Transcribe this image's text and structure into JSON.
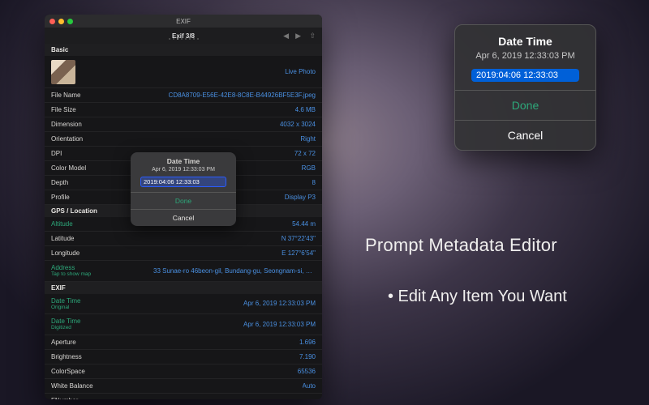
{
  "window": {
    "title": "EXIF",
    "counter": "Exif 3/8",
    "live_photo": "Live Photo",
    "sections": {
      "basic": "Basic",
      "gps": "GPS / Location",
      "exif": "EXIF"
    },
    "rows": {
      "file_name": {
        "label": "File Name",
        "value": "CD8A8709-E56E-42E8-8C8E-B44926BF5E3F.jpeg"
      },
      "file_size": {
        "label": "File Size",
        "value": "4.6 MB"
      },
      "dimension": {
        "label": "Dimension",
        "value": "4032 x 3024"
      },
      "orientation": {
        "label": "Orientation",
        "value": "Right"
      },
      "dpi": {
        "label": "DPI",
        "value": "72 x 72"
      },
      "color_model": {
        "label": "Color Model",
        "value": "RGB"
      },
      "depth": {
        "label": "Depth",
        "value": "8"
      },
      "profile": {
        "label": "Profile",
        "value": "Display P3"
      },
      "altitude": {
        "label": "Altitude",
        "value": "54.44 m"
      },
      "latitude": {
        "label": "Latitude",
        "value": "N 37°22'43\""
      },
      "longitude": {
        "label": "Longitude",
        "value": "E 127°6'54\""
      },
      "address": {
        "label": "Address",
        "sub": "Tap to show map",
        "value": "33 Sunae-ro 46beon-gil, Bundang-gu, Seongnam-si, Gyeonggi-…"
      },
      "date_time_orig": {
        "label": "Date Time",
        "sub": "Original",
        "value": "Apr 6, 2019 12:33:03 PM"
      },
      "date_time_digi": {
        "label": "Date Time",
        "sub": "Digitized",
        "value": "Apr 6, 2019 12:33:03 PM"
      },
      "aperture": {
        "label": "Aperture",
        "value": "1.696"
      },
      "brightness": {
        "label": "Brightness",
        "value": "7.190"
      },
      "colorspace": {
        "label": "ColorSpace",
        "value": "65536"
      },
      "white_balance": {
        "label": "White Balance",
        "value": "Auto"
      },
      "fnumber": {
        "label": "FNumber",
        "value": ""
      }
    }
  },
  "popup": {
    "title": "Date Time",
    "subtitle": "Apr 6, 2019 12:33:03 PM",
    "input": "2019:04:06 12:33:03",
    "done": "Done",
    "cancel": "Cancel"
  },
  "marketing": {
    "line1": "Prompt Metadata Editor",
    "line2": "• Edit Any Item You Want"
  }
}
